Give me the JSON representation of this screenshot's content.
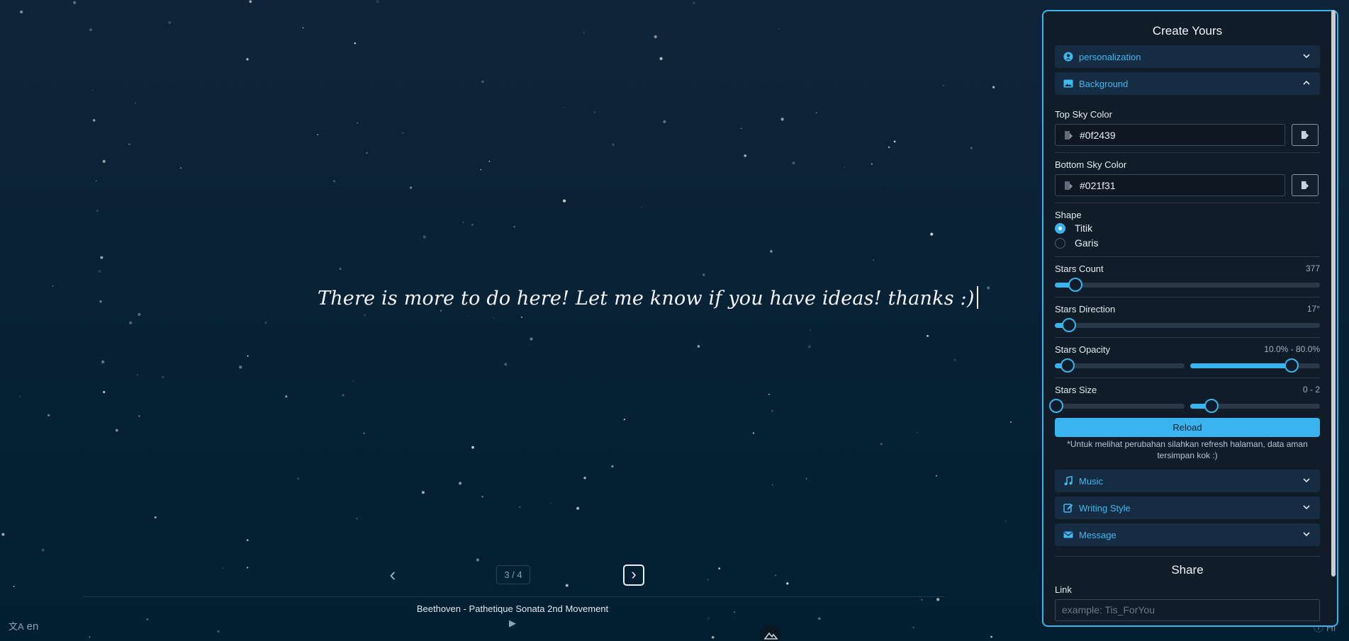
{
  "scene": {
    "message": "There is more to do here! Let me know if you have ideas! thanks :)",
    "page": "3 / 4",
    "track_title": "Beethoven - Pathetique Sonata 2nd Movement",
    "language": "en",
    "hi_link": "Hi"
  },
  "panel": {
    "title": "Create Yours",
    "sections": {
      "personalization": "personalization",
      "background": "Background",
      "music": "Music",
      "writing_style": "Writing Style",
      "message": "Message"
    },
    "top_sky": {
      "label": "Top Sky Color",
      "value": "#0f2439"
    },
    "bottom_sky": {
      "label": "Bottom Sky Color",
      "value": "#021f31"
    },
    "shape": {
      "label": "Shape",
      "options": [
        "Titik",
        "Garis"
      ],
      "selected": "Titik"
    },
    "stars_count": {
      "label": "Stars Count",
      "value_text": "377"
    },
    "stars_direction": {
      "label": "Stars Direction",
      "value_text": "17°"
    },
    "stars_opacity": {
      "label": "Stars Opacity",
      "value_text": "10.0% - 80.0%"
    },
    "stars_size": {
      "label": "Stars Size",
      "value_text": "0 - 2"
    },
    "reload_label": "Reload",
    "note": "*Untuk melihat perubahan silahkan refresh halaman, data aman tersimpan kok :)",
    "share": {
      "title": "Share",
      "link_label": "Link",
      "link_placeholder": "example: Tis_ForYou"
    }
  },
  "colors": {
    "accent": "#39b4ee",
    "panel_bg": "#111c29",
    "sky_top": "#0f2439",
    "sky_bottom": "#021f31"
  }
}
